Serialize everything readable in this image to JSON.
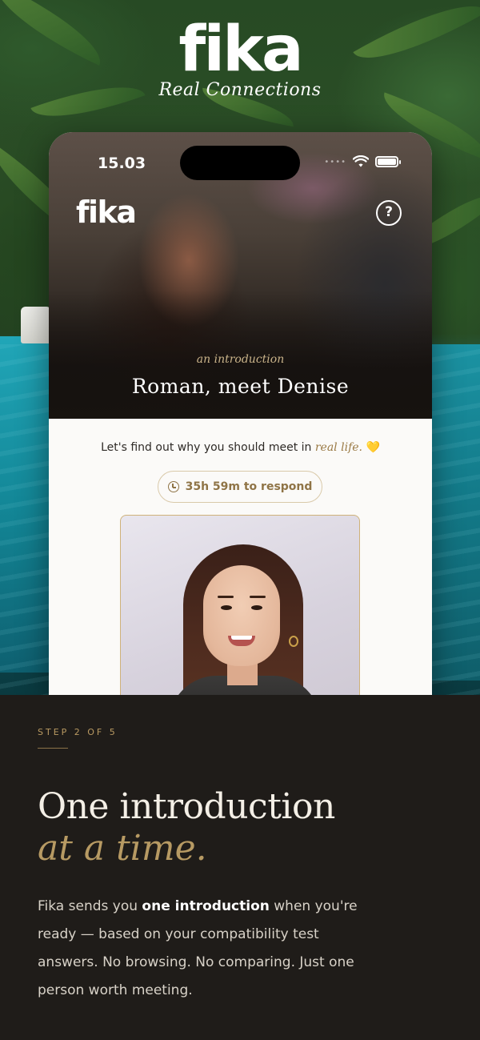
{
  "brand": {
    "logo": "fika",
    "tagline": "Real Connections"
  },
  "phone": {
    "status_time": "15.03",
    "app_logo": "fika",
    "help_icon": "?",
    "intro_label": "an introduction",
    "intro_title": "Roman, meet Denise",
    "find_prefix": "Let's find out why you should meet in",
    "find_emphasis": "real life.",
    "find_emoji": "💛",
    "timer_label": "35h 59m to respond"
  },
  "step": {
    "label": "STEP 2 OF 5"
  },
  "headline": {
    "line1": "One introduction",
    "line2": "at a time."
  },
  "body": {
    "part1": "Fika sends you ",
    "bold": "one introduction",
    "part2": " when you're ready — based on your compatibility test answers. No browsing. No comparing. Just one person worth meeting."
  },
  "colors": {
    "accent_gold": "#b79a63",
    "dark_bg": "#1f1c19",
    "pool_teal": "#13656e"
  }
}
